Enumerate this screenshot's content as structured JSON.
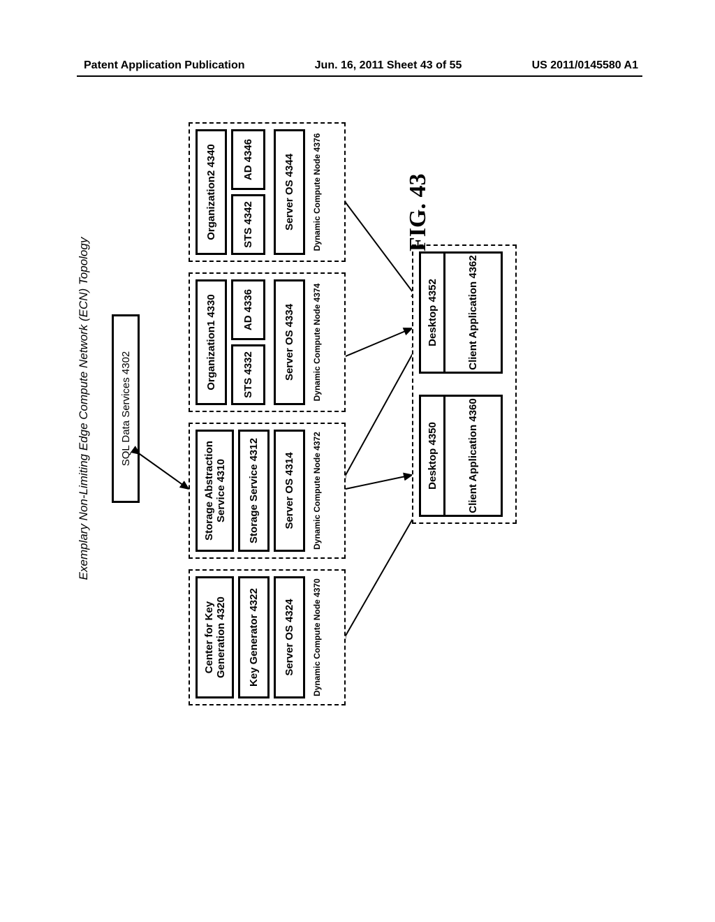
{
  "header": {
    "left": "Patent Application Publication",
    "center": "Jun. 16, 2011  Sheet 43 of 55",
    "right": "US 2011/0145580 A1"
  },
  "diagram": {
    "title": "Exemplary Non-Limiting Edge Compute Network (ECN) Topology",
    "sql": "SQL Data Services 4302",
    "fig": "FIG. 43",
    "nodes": {
      "n1": {
        "top": "Center for Key Generation 4320",
        "mid": "Key Generator 4322",
        "os": "Server OS 4324",
        "cap": "Dynamic Compute Node 4370"
      },
      "n2": {
        "top": "Storage Abstraction Service 4310",
        "mid": "Storage Service 4312",
        "os": "Server OS 4314",
        "cap": "Dynamic Compute Node 4372"
      },
      "n3": {
        "top": "Organization1 4330",
        "sts": "STS 4332",
        "ad": "AD 4336",
        "os": "Server OS 4334",
        "cap": "Dynamic Compute Node 4374"
      },
      "n4": {
        "top": "Organization2 4340",
        "sts": "STS 4342",
        "ad": "AD 4346",
        "os": "Server OS 4344",
        "cap": "Dynamic Compute Node 4376"
      }
    },
    "desktops": {
      "d1": {
        "title": "Desktop 4350",
        "app": "Client Application 4360"
      },
      "d2": {
        "title": "Desktop 4352",
        "app": "Client Application 4362"
      }
    }
  }
}
